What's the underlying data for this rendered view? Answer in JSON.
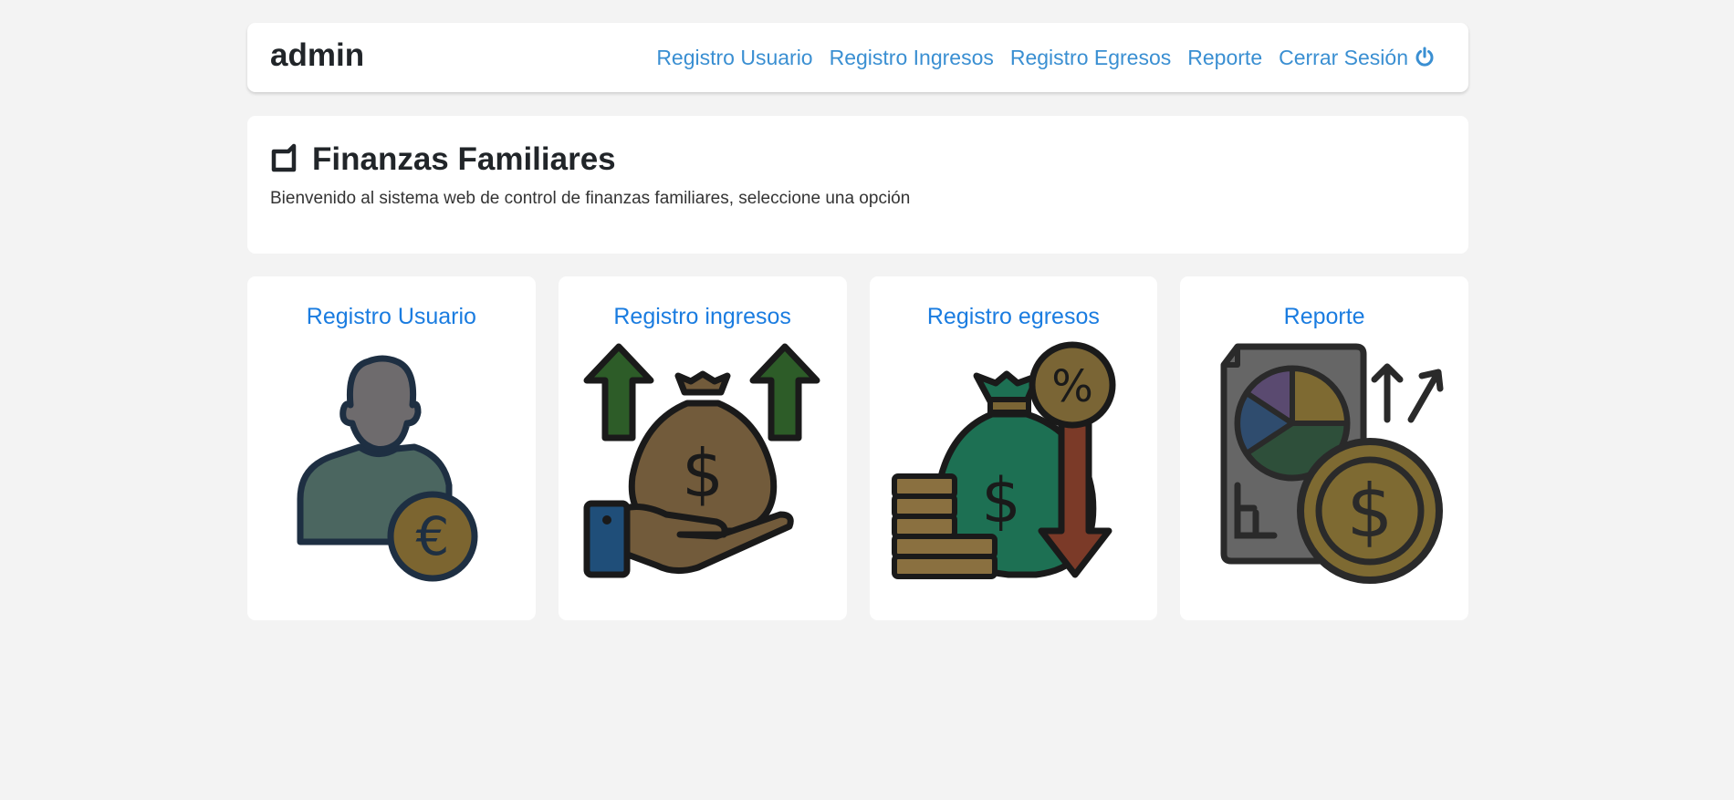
{
  "navbar": {
    "brand": "admin",
    "links": [
      {
        "label": "Registro Usuario"
      },
      {
        "label": "Registro Ingresos"
      },
      {
        "label": "Registro Egresos"
      },
      {
        "label": "Reporte"
      },
      {
        "label": "Cerrar Sesión",
        "icon": "power-icon"
      }
    ]
  },
  "hero": {
    "title": "Finanzas Familiares",
    "icon": "square-logo-icon",
    "subtitle": "Bienvenido al sistema web de control de finanzas familiares, seleccione una opción"
  },
  "cards": [
    {
      "title": "Registro Usuario",
      "icon": "user-euro-icon"
    },
    {
      "title": "Registro ingresos",
      "icon": "income-money-bag-icon"
    },
    {
      "title": "Registro egresos",
      "icon": "expense-money-bag-icon"
    },
    {
      "title": "Reporte",
      "icon": "report-chart-icon"
    }
  ],
  "colors": {
    "background": "#f3f3f3",
    "link": "#3a8fd2",
    "card_title": "#1a7ce0",
    "text": "#212529"
  }
}
